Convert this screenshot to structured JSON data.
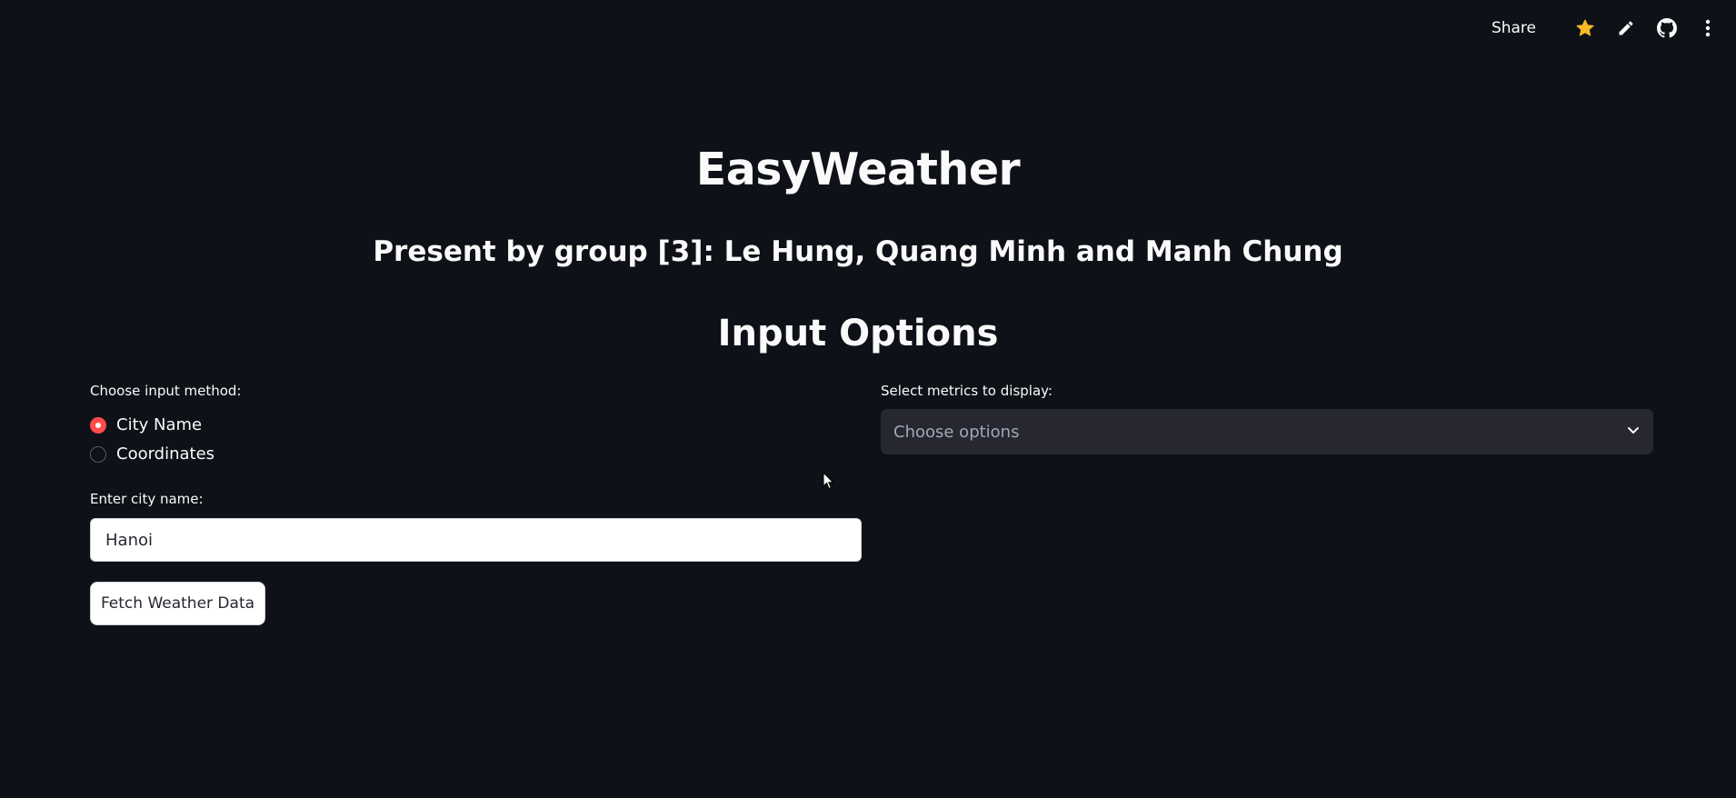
{
  "toolbar": {
    "share_label": "Share",
    "icons": [
      "star-icon",
      "pencil-icon",
      "github-icon",
      "more-vertical-icon"
    ],
    "star_color": "#f9b922"
  },
  "header": {
    "title": "EasyWeather",
    "subtitle": "Present by group [3]: Le Hung, Quang Minh and Manh Chung"
  },
  "section": {
    "title": "Input Options"
  },
  "input_method": {
    "label": "Choose input method:",
    "options": [
      "City Name",
      "Coordinates"
    ],
    "selected": "City Name",
    "accent_color": "#ff4b4b"
  },
  "city": {
    "label": "Enter city name:",
    "value": "Hanoi"
  },
  "fetch_button": {
    "label": "Fetch Weather Data"
  },
  "metrics": {
    "label": "Select metrics to display:",
    "placeholder": "Choose options"
  },
  "colors": {
    "background": "#0e1117",
    "select_background": "#262730"
  }
}
